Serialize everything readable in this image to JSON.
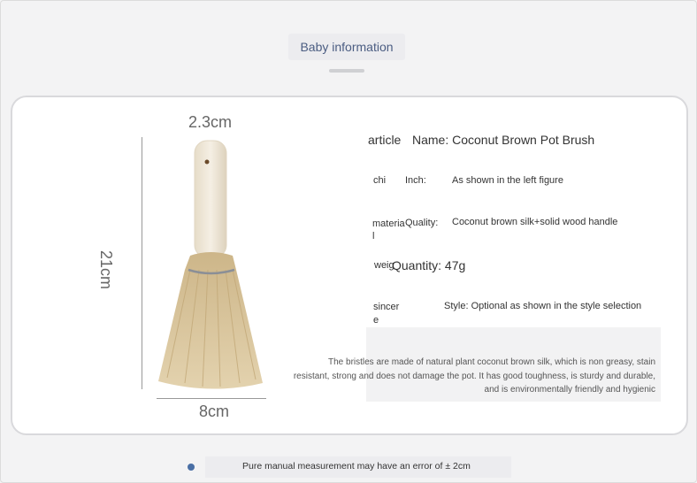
{
  "header": {
    "title": "Baby information"
  },
  "dimensions": {
    "top": "2.3cm",
    "side": "21cm",
    "bottom": "8cm"
  },
  "info": {
    "article_key": "article",
    "name": "Name: Coconut Brown Pot Brush",
    "chi_key": "chi",
    "inch_label": "Inch:",
    "inch_value": "As shown in the left figure",
    "material_key": "materia l",
    "quality_label": "Quality:",
    "quality_value": "Coconut brown silk+solid wood handle",
    "weight_key": "weig",
    "quantity": "Quantity: 47g",
    "sincere_key": "sincer e",
    "style": "Style: Optional as shown in the style selection"
  },
  "description": "The bristles are made of natural plant coconut brown silk, which is non greasy, stain resistant, strong and does not damage the pot. It has good toughness, is sturdy and durable, and is environmentally friendly and hygienic",
  "footer": {
    "note": "Pure manual measurement may have an error of ± 2cm"
  },
  "colors": {
    "accent": "#4a6fa5",
    "title_text": "#4b5d82",
    "bristle": "#d8c49e",
    "handle": "#efe6d4"
  }
}
